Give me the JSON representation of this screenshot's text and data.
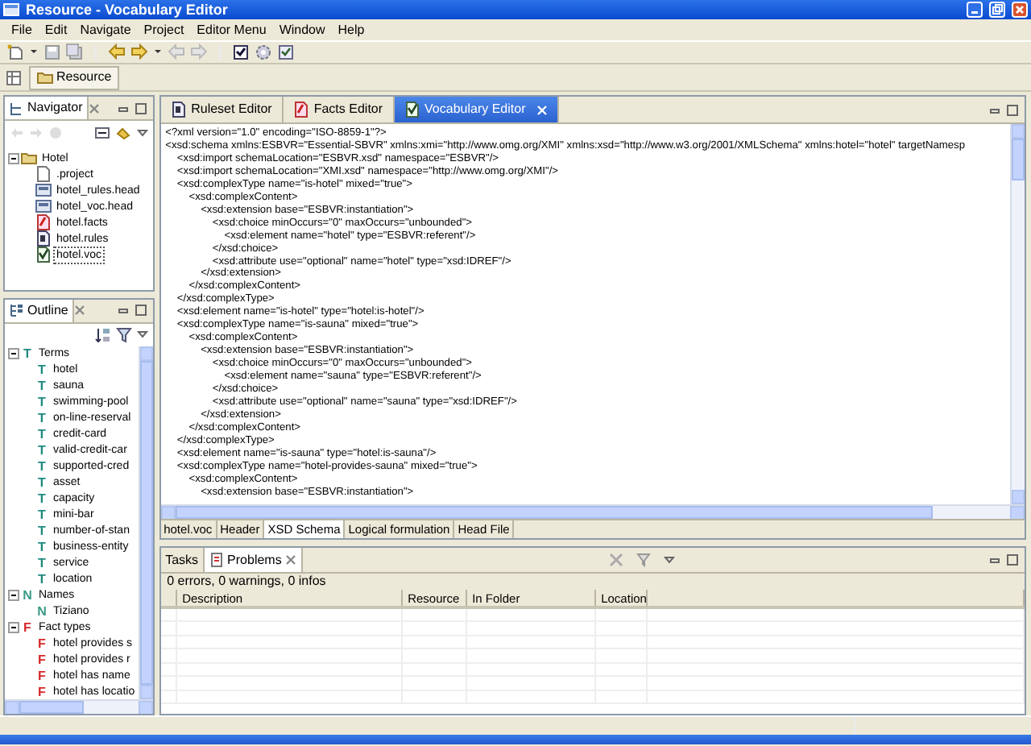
{
  "window": {
    "title": "Resource - Vocabulary Editor"
  },
  "menu": [
    "File",
    "Edit",
    "Navigate",
    "Project",
    "Editor Menu",
    "Window",
    "Help"
  ],
  "perspective": {
    "label": "Resource"
  },
  "navigator": {
    "title": "Navigator",
    "tree": [
      {
        "label": "Hotel",
        "kind": "project",
        "expanded": true,
        "selected": false,
        "children": [
          {
            "label": ".project",
            "kind": "file",
            "selected": false
          },
          {
            "label": "hotel_rules.head",
            "kind": "head",
            "selected": false
          },
          {
            "label": "hotel_voc.head",
            "kind": "head",
            "selected": false
          },
          {
            "label": "hotel.facts",
            "kind": "facts",
            "selected": false
          },
          {
            "label": "hotel.rules",
            "kind": "rules",
            "selected": false
          },
          {
            "label": "hotel.voc",
            "kind": "voc",
            "selected": true
          }
        ]
      }
    ]
  },
  "outline": {
    "title": "Outline",
    "tree": [
      {
        "icon": "T",
        "label": "Terms",
        "kind": "term",
        "expanded": true,
        "children": [
          {
            "icon": "T",
            "label": "hotel"
          },
          {
            "icon": "T",
            "label": "sauna"
          },
          {
            "icon": "T",
            "label": "swimming-pool"
          },
          {
            "icon": "T",
            "label": "on-line-reserval"
          },
          {
            "icon": "T",
            "label": "credit-card"
          },
          {
            "icon": "T",
            "label": "valid-credit-car"
          },
          {
            "icon": "T",
            "label": "supported-cred"
          },
          {
            "icon": "T",
            "label": "asset"
          },
          {
            "icon": "T",
            "label": "capacity"
          },
          {
            "icon": "T",
            "label": "mini-bar"
          },
          {
            "icon": "T",
            "label": "number-of-stan"
          },
          {
            "icon": "T",
            "label": "business-entity"
          },
          {
            "icon": "T",
            "label": "service"
          },
          {
            "icon": "T",
            "label": "location"
          }
        ]
      },
      {
        "icon": "N",
        "label": "Names",
        "kind": "name",
        "expanded": true,
        "children": [
          {
            "icon": "N",
            "label": "Tiziano"
          }
        ]
      },
      {
        "icon": "F",
        "label": "Fact types",
        "kind": "fact",
        "expanded": true,
        "children": [
          {
            "icon": "F",
            "label": "hotel provides s"
          },
          {
            "icon": "F",
            "label": "hotel provides r"
          },
          {
            "icon": "F",
            "label": "hotel has name"
          },
          {
            "icon": "F",
            "label": "hotel has locatio"
          }
        ]
      }
    ]
  },
  "editor": {
    "tabs": [
      {
        "label": "Ruleset Editor",
        "kind": "ruleset",
        "selected": false
      },
      {
        "label": "Facts Editor",
        "kind": "facts",
        "selected": false
      },
      {
        "label": "Vocabulary Editor",
        "kind": "voc",
        "selected": true
      }
    ],
    "lines": [
      "<?xml version=\"1.0\" encoding=\"ISO-8859-1\"?>",
      "<xsd:schema xmlns:ESBVR=\"Essential-SBVR\" xmlns:xmi=\"http://www.omg.org/XMI\" xmlns:xsd=\"http://www.w3.org/2001/XMLSchema\" xmlns:hotel=\"hotel\" targetNamesp",
      "    <xsd:import schemaLocation=\"ESBVR.xsd\" namespace=\"ESBVR\"/>",
      "    <xsd:import schemaLocation=\"XMI.xsd\" namespace=\"http://www.omg.org/XMI\"/>",
      "    <xsd:complexType name=\"is-hotel\" mixed=\"true\">",
      "        <xsd:complexContent>",
      "            <xsd:extension base=\"ESBVR:instantiation\">",
      "                <xsd:choice minOccurs=\"0\" maxOccurs=\"unbounded\">",
      "                    <xsd:element name=\"hotel\" type=\"ESBVR:referent\"/>",
      "                </xsd:choice>",
      "                <xsd:attribute use=\"optional\" name=\"hotel\" type=\"xsd:IDREF\"/>",
      "            </xsd:extension>",
      "        </xsd:complexContent>",
      "    </xsd:complexType>",
      "    <xsd:element name=\"is-hotel\" type=\"hotel:is-hotel\"/>",
      "    <xsd:complexType name=\"is-sauna\" mixed=\"true\">",
      "        <xsd:complexContent>",
      "            <xsd:extension base=\"ESBVR:instantiation\">",
      "                <xsd:choice minOccurs=\"0\" maxOccurs=\"unbounded\">",
      "                    <xsd:element name=\"sauna\" type=\"ESBVR:referent\"/>",
      "                </xsd:choice>",
      "                <xsd:attribute use=\"optional\" name=\"sauna\" type=\"xsd:IDREF\"/>",
      "            </xsd:extension>",
      "        </xsd:complexContent>",
      "    </xsd:complexType>",
      "    <xsd:element name=\"is-sauna\" type=\"hotel:is-sauna\"/>",
      "    <xsd:complexType name=\"hotel-provides-sauna\" mixed=\"true\">",
      "        <xsd:complexContent>",
      "            <xsd:extension base=\"ESBVR:instantiation\">"
    ],
    "page_tabs": [
      {
        "label": "hotel.voc",
        "selected": false
      },
      {
        "label": "Header",
        "selected": false
      },
      {
        "label": "XSD Schema",
        "selected": true
      },
      {
        "label": "Logical formulation",
        "selected": false
      },
      {
        "label": "Head File",
        "selected": false
      }
    ]
  },
  "problems": {
    "tabs": [
      {
        "label": "Tasks",
        "selected": false
      },
      {
        "label": "Problems",
        "selected": true
      }
    ],
    "summary": "0 errors, 0 warnings, 0 infos",
    "columns": [
      "Description",
      "Resource",
      "In Folder",
      "Location"
    ]
  }
}
